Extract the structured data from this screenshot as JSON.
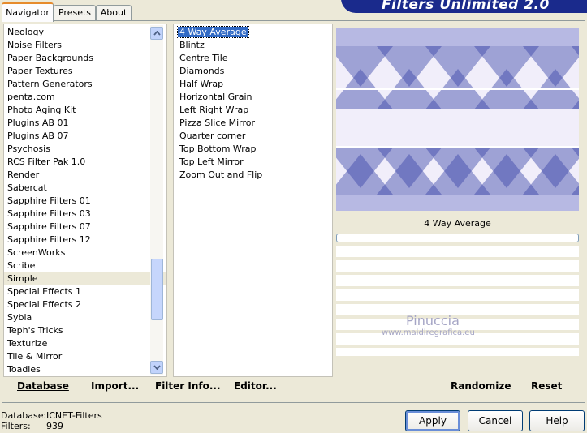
{
  "tabs": [
    {
      "label": "Navigator",
      "active": true
    },
    {
      "label": "Presets"
    },
    {
      "label": "About"
    }
  ],
  "title": "Filters Unlimited 2.0",
  "categories": [
    "Neology",
    "Noise Filters",
    "Paper Backgrounds",
    "Paper Textures",
    "Pattern Generators",
    "penta.com",
    "Photo Aging Kit",
    "Plugins AB 01",
    "Plugins AB 07",
    "Psychosis",
    "RCS Filter Pak 1.0",
    "Render",
    "Sabercat",
    "Sapphire Filters 01",
    "Sapphire Filters 03",
    "Sapphire Filters 07",
    "Sapphire Filters 12",
    "ScreenWorks",
    "Scribe",
    "Simple",
    "Special Effects 1",
    "Special Effects 2",
    "Sybia",
    "Teph's Tricks",
    "Texturize",
    "Tile & Mirror",
    "Toadies"
  ],
  "selected_category": "Simple",
  "filters": [
    "4 Way Average",
    "Blintz",
    "Centre Tile",
    "Diamonds",
    "Half Wrap",
    "Horizontal Grain",
    "Left Right Wrap",
    "Pizza Slice Mirror",
    "Quarter corner",
    "Top Bottom Wrap",
    "Top Left Mirror",
    "Zoom Out and Flip"
  ],
  "selected_filter": "4 Way Average",
  "preview": {
    "filter_name": "4 Way Average",
    "watermark_name": "Pinuccia",
    "watermark_url": "www.maidiregrafica.eu",
    "progress": 0
  },
  "toolbar": {
    "database": "Database",
    "import": "Import...",
    "filter_info": "Filter Info...",
    "editor": "Editor...",
    "randomize": "Randomize",
    "reset": "Reset"
  },
  "status": {
    "database_label": "Database:",
    "database_value": "ICNET-Filters",
    "filters_label": "Filters:",
    "filters_value": "939"
  },
  "buttons": {
    "apply": "Apply",
    "cancel": "Cancel",
    "help": "Help"
  },
  "colors": {
    "accent": "#316ac5",
    "preview_blue": "#4b56b8",
    "banner": "#1a2a8c"
  }
}
